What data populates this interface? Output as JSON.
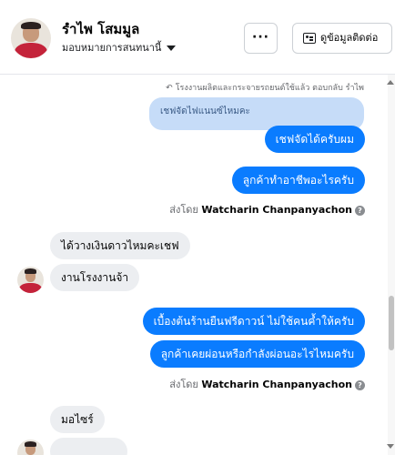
{
  "header": {
    "name": "รำไพ โสมมูล",
    "subtitle": "มอบหมายการสนทนานี้",
    "more_label": "···",
    "contact_label": "ดูข้อมูลติดต่อ",
    "avatar_icon": "profile-avatar",
    "dropdown_icon": "caret-down-icon"
  },
  "conversation": {
    "reply_note": "โรงงานผลิตและกระจายรถยนต์ใช้แล้ว ตอบกลับ รำไพ",
    "quoted_text": "เชฟจัดไฟแนนซ์ไหมคะ",
    "messages": [
      {
        "direction": "out",
        "text": "เชฟจัดได้ครับผม"
      },
      {
        "direction": "out",
        "text": "ลูกค้าทำอาชีพอะไรครับ"
      },
      {
        "direction": "in",
        "text": "ได้วางเงินดาวไหมคะเชฟ"
      },
      {
        "direction": "in",
        "text": "งานโรงงานจ้า"
      },
      {
        "direction": "out",
        "text": "เบื้องต้นร้านยืนฟรีดาวน์ ไม่ใช้คนค้ำให้ครับ"
      },
      {
        "direction": "out",
        "text": "ลูกค้าเคยผ่อนหรือกำลังผ่อนอะไรไหมครับ"
      },
      {
        "direction": "in",
        "text": "มอไซร์"
      }
    ],
    "sent_by_prefix": "ส่งโดย",
    "sent_by_name": "Watcharin Chanpanyachon",
    "help_icon": "?"
  },
  "colors": {
    "outgoing_bubble": "#0a7cff",
    "incoming_bubble": "#eceef1",
    "quoted_bubble": "#c6dcf8"
  }
}
